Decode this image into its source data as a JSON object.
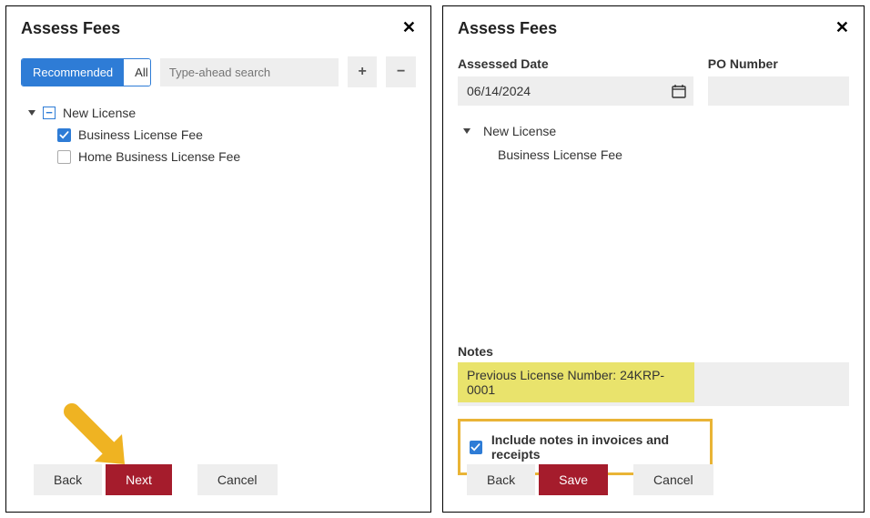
{
  "panel1": {
    "title": "Assess Fees",
    "tabs": {
      "recommended": "Recommended",
      "all": "All"
    },
    "search_placeholder": "Type-ahead search",
    "tree": {
      "root": "New License",
      "items": [
        {
          "label": "Business License Fee",
          "checked": true
        },
        {
          "label": "Home Business License Fee",
          "checked": false
        }
      ]
    },
    "buttons": {
      "back": "Back",
      "next": "Next",
      "cancel": "Cancel"
    }
  },
  "panel2": {
    "title": "Assess Fees",
    "fields": {
      "assessed_date_label": "Assessed Date",
      "assessed_date_value": "06/14/2024",
      "po_number_label": "PO Number",
      "po_number_value": ""
    },
    "tree": {
      "root": "New License",
      "child": "Business License Fee"
    },
    "notes_label": "Notes",
    "notes_value": "Previous License Number: 24KRP-0001",
    "include_label": "Include notes in invoices and receipts",
    "include_checked": true,
    "buttons": {
      "back": "Back",
      "save": "Save",
      "cancel": "Cancel"
    }
  }
}
